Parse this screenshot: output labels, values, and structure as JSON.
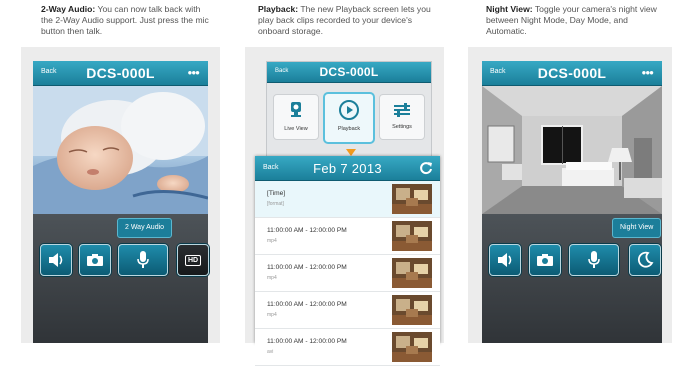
{
  "panels": [
    {
      "caption_title": "2-Way Audio:",
      "caption_body": " You can now talk back with the 2-Way Audio support. Just press the mic button then talk.",
      "back_label": "Back",
      "title": "DCS-000L",
      "tip_label": "2 Way Audio",
      "buttons": [
        "speaker-icon",
        "camera-icon",
        "microphone-icon",
        "hd-icon"
      ],
      "hd_label": "HD"
    },
    {
      "caption_title": "Playback:",
      "caption_body": " The new Playback screen lets you play back clips recorded to your device's onboard storage.",
      "header_title": "DCS-000L",
      "header_back": "Back",
      "menu": [
        {
          "icon": "live-view-icon",
          "label": "Live View"
        },
        {
          "icon": "playback-icon",
          "label": "Playback"
        },
        {
          "icon": "settings-icon",
          "label": "Settings"
        }
      ],
      "list_back": "Back",
      "list_title": "Feb 7 2013",
      "clips": [
        {
          "time": "[Time]",
          "format": "[format]"
        },
        {
          "time": "11:00:00 AM - 12:00:00 PM",
          "format": "mp4"
        },
        {
          "time": "11:00:00 AM - 12:00:00 PM",
          "format": "mp4"
        },
        {
          "time": "11:00:00 AM - 12:00:00 PM",
          "format": "mp4"
        },
        {
          "time": "11:00:00 AM - 12:00:00 PM",
          "format": "avi"
        }
      ]
    },
    {
      "caption_title": "Night View:",
      "caption_body": " Toggle your camera's night view between Night Mode, Day Mode, and Automatic.",
      "back_label": "Back",
      "title": "DCS-000L",
      "tip_label": "Night View",
      "buttons": [
        "speaker-icon",
        "camera-icon",
        "microphone-icon",
        "night-mode-icon"
      ]
    }
  ]
}
